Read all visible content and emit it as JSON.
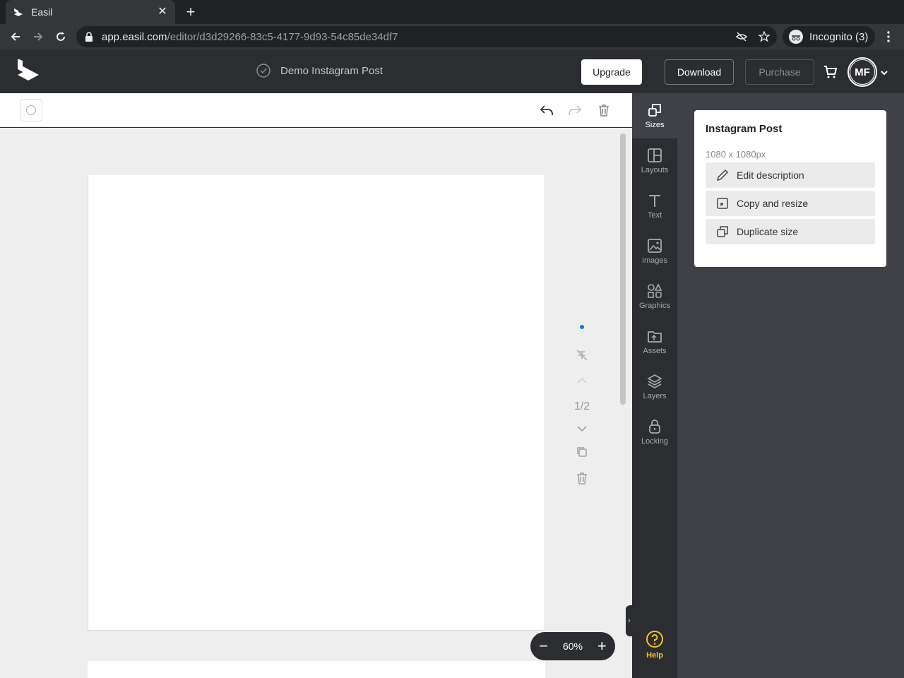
{
  "browser": {
    "tab_title": "Easil",
    "url_host": "app.easil.com",
    "url_path": "/editor/d3d29266-83c5-4177-9d93-54c85de34df7",
    "incognito_label": "Incognito (3)"
  },
  "header": {
    "doc_title": "Demo Instagram Post",
    "upgrade_label": "Upgrade",
    "download_label": "Download",
    "purchase_label": "Purchase",
    "avatar_initials": "MF"
  },
  "canvas": {
    "page_counter": "1/2",
    "zoom_label": "60%"
  },
  "side_nav": {
    "items": [
      {
        "label": "Sizes",
        "icon": "sizes-icon"
      },
      {
        "label": "Layouts",
        "icon": "layouts-icon"
      },
      {
        "label": "Text",
        "icon": "text-icon"
      },
      {
        "label": "Images",
        "icon": "images-icon"
      },
      {
        "label": "Graphics",
        "icon": "graphics-icon"
      },
      {
        "label": "Assets",
        "icon": "assets-icon"
      },
      {
        "label": "Layers",
        "icon": "layers-icon"
      },
      {
        "label": "Locking",
        "icon": "lock-icon"
      }
    ],
    "help_label": "Help"
  },
  "panel": {
    "title": "Instagram Post",
    "size": "1080 x 1080px",
    "edit_description": "Edit description",
    "copy_resize": "Copy and resize",
    "duplicate_size": "Duplicate size"
  },
  "colors": {
    "accent_blue": "#1a73e8",
    "help_yellow": "#f5c518",
    "dark_bg": "#2b2d31"
  }
}
